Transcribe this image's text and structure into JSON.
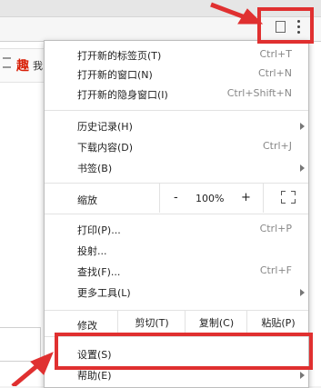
{
  "background": {
    "logo_glyph": "趣",
    "text_fragment": "我"
  },
  "menu": {
    "items_top": [
      {
        "label": "打开新的标签页(T)",
        "shortcut": "Ctrl+T"
      },
      {
        "label": "打开新的窗口(N)",
        "shortcut": "Ctrl+N"
      },
      {
        "label": "打开新的隐身窗口(I)",
        "shortcut": "Ctrl+Shift+N"
      }
    ],
    "items_history": [
      {
        "label": "历史记录(H)",
        "shortcut": ""
      },
      {
        "label": "下载内容(D)",
        "shortcut": "Ctrl+J"
      },
      {
        "label": "书签(B)",
        "shortcut": ""
      }
    ],
    "zoom": {
      "label": "缩放",
      "minus": "-",
      "value": "100%",
      "plus": "+"
    },
    "items_tools": [
      {
        "label": "打印(P)...",
        "shortcut": "Ctrl+P"
      },
      {
        "label": "投射...",
        "shortcut": ""
      },
      {
        "label": "查找(F)...",
        "shortcut": "Ctrl+F"
      },
      {
        "label": "更多工具(L)",
        "shortcut": ""
      }
    ],
    "edit": {
      "label": "修改",
      "cut": "剪切(T)",
      "copy": "复制(C)",
      "paste": "粘贴(P)"
    },
    "items_bottom": [
      {
        "label": "设置(S)",
        "shortcut": ""
      },
      {
        "label": "帮助(E)",
        "shortcut": ""
      }
    ]
  },
  "annotation": {
    "color": "#e03030"
  }
}
